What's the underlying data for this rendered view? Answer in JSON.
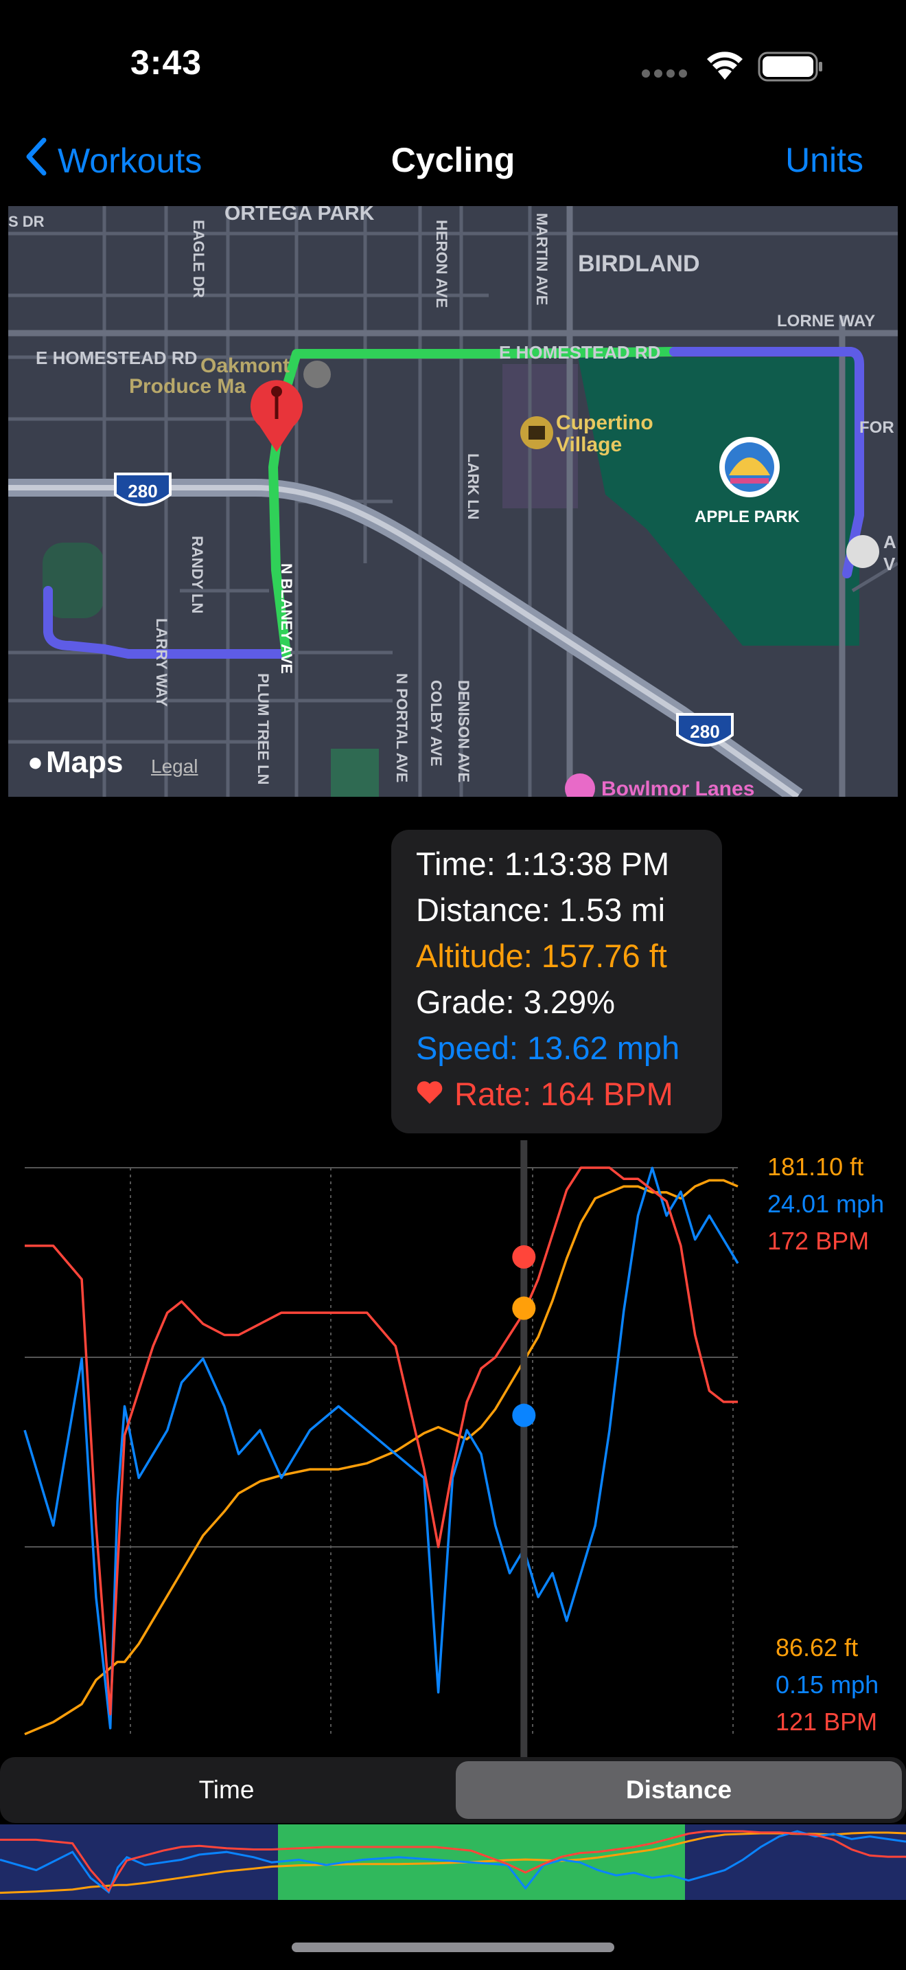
{
  "status_bar": {
    "time": "3:43",
    "icons": [
      "signal-icon",
      "wifi-icon",
      "battery-icon"
    ]
  },
  "nav": {
    "back_label": "Workouts",
    "title": "Cycling",
    "units_label": "Units"
  },
  "map": {
    "labels": [
      "ORTEGA PARK",
      "BIRDLAND",
      "LORNE WAY",
      "E HOMESTEAD RD",
      "E HOMESTEAD RD",
      "Oakmont",
      "Produce Ma",
      "Cupertino",
      "Village",
      "APPLE PARK",
      "FOR",
      "280",
      "280",
      "LARRY WAY",
      "RANDY LN",
      "N BLANEY AVE",
      "PLUM TREE LN",
      "N PORTAL AVE",
      "COLBY AVE",
      "DENISON AVE",
      "LARK LN",
      "HERON AVE",
      "MARTIN AVE",
      "EAGLE DR",
      "Bowlmor Lanes",
      "A",
      "V",
      "S DR"
    ],
    "brand": "Maps",
    "legal": "Legal",
    "route_colors": {
      "start": "#5e5ce6",
      "middle": "#30d158",
      "end": "#5e5ce6"
    },
    "pin_color": "#e8343a"
  },
  "tooltip": {
    "time": "Time: 1:13:38 PM",
    "distance": "Distance: 1.53 mi",
    "altitude": "Altitude: 157.76 ft",
    "grade": "Grade: 3.29%",
    "speed": "Speed: 13.62 mph",
    "rate": "Rate: 164 BPM",
    "heart_icon": "heart-icon"
  },
  "chart_data": {
    "type": "line",
    "xlabel": "",
    "ylabel": "",
    "x": [
      0,
      0.04,
      0.08,
      0.1,
      0.12,
      0.13,
      0.14,
      0.16,
      0.18,
      0.2,
      0.22,
      0.25,
      0.28,
      0.3,
      0.33,
      0.36,
      0.4,
      0.44,
      0.48,
      0.52,
      0.56,
      0.58,
      0.6,
      0.62,
      0.64,
      0.66,
      0.68,
      0.7,
      0.72,
      0.74,
      0.76,
      0.78,
      0.8,
      0.82,
      0.84,
      0.86,
      0.88,
      0.9,
      0.92,
      0.94,
      0.96,
      0.98,
      1.0
    ],
    "y_left_range": [
      86.62,
      181.1
    ],
    "series": [
      {
        "name": "Altitude",
        "unit": "ft",
        "color": "#ff9f0a",
        "range": [
          "86.62 ft",
          "181.10 ft"
        ],
        "values": [
          87,
          89,
          92,
          96,
          98,
          99,
          99,
          102,
          106,
          110,
          114,
          120,
          124,
          127,
          129,
          130,
          131,
          131,
          132,
          134,
          137,
          138,
          137,
          136,
          138,
          141,
          145,
          149,
          153,
          159,
          166,
          172,
          176,
          177,
          178,
          178,
          177,
          177,
          176,
          178,
          179,
          179,
          178
        ]
      },
      {
        "name": "Speed",
        "unit": "mph",
        "color": "#0a84ff",
        "range": [
          "0.15 mph",
          "24.01 mph"
        ],
        "values": [
          13,
          9,
          16,
          6,
          0.5,
          10,
          14,
          11,
          12,
          13,
          15,
          16,
          14,
          12,
          13,
          11,
          13,
          14,
          13,
          12,
          11,
          2,
          11,
          13,
          12,
          9,
          7,
          8,
          6,
          7,
          5,
          7,
          9,
          13,
          18,
          22,
          24,
          22,
          23,
          21,
          22,
          21,
          20
        ]
      },
      {
        "name": "Heart Rate",
        "unit": "BPM",
        "color": "#ff453a",
        "range": [
          "121 BPM",
          "172 BPM"
        ],
        "values": [
          165,
          165,
          162,
          140,
          123,
          136,
          148,
          152,
          156,
          159,
          160,
          158,
          157,
          157,
          158,
          159,
          159,
          159,
          159,
          156,
          145,
          138,
          145,
          151,
          154,
          155,
          157,
          159,
          162,
          166,
          170,
          172,
          172,
          172,
          171,
          171,
          170,
          169,
          165,
          157,
          152,
          151,
          151
        ]
      }
    ],
    "selected_x": 0.7,
    "selected_values": {
      "Altitude": 157.76,
      "Speed": 13.62,
      "Heart Rate": 164
    },
    "axis_labels_right_top": [
      "181.10 ft",
      "24.01 mph",
      "172 BPM"
    ],
    "axis_labels_right_bottom": [
      "86.62 ft",
      "0.15 mph",
      "121 BPM"
    ],
    "grid": true,
    "legend": "none"
  },
  "segmented": {
    "options": [
      "Time",
      "Distance"
    ],
    "selected": "Distance"
  },
  "overview": {
    "zones": [
      "#1e2a66",
      "#30b85c",
      "#1e2a66"
    ]
  }
}
